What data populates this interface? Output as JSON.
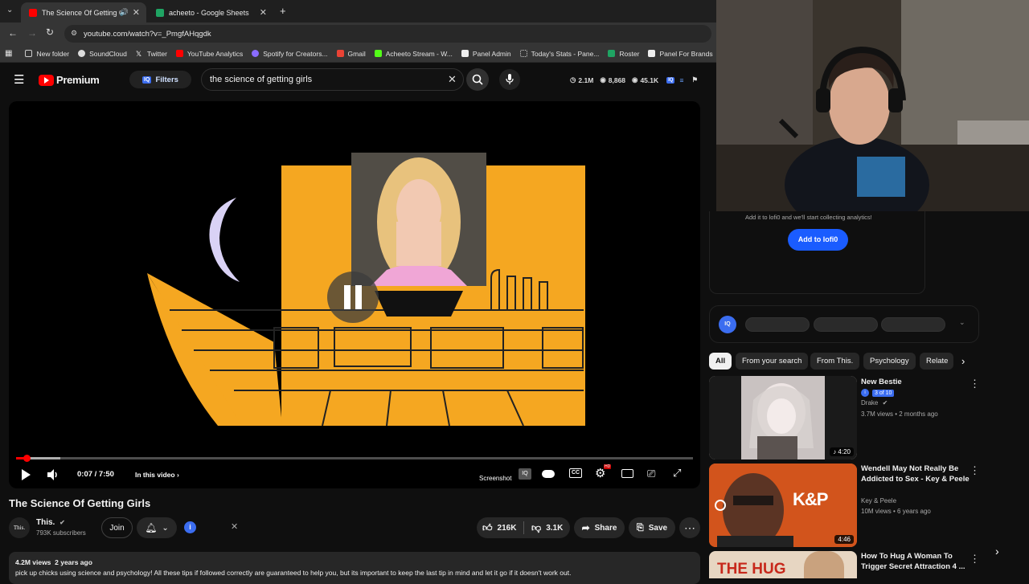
{
  "browser": {
    "tabs": [
      {
        "title": "The Science Of Getting Girls",
        "active": true
      },
      {
        "title": "acheeto - Google Sheets",
        "active": false
      }
    ],
    "url": "youtube.com/watch?v=_PmgfAHqgdk",
    "bookmarks": [
      "New folder",
      "SoundCloud",
      "Twitter",
      "YouTube Analytics",
      "Spotify for Creators...",
      "Gmail",
      "Acheeto Stream - W...",
      "Panel Admin",
      "Today's Stats - Pane...",
      "Roster",
      "Panel For Brands"
    ]
  },
  "header": {
    "logo": "Premium",
    "filters": "Filters",
    "search_value": "the science of getting girls",
    "stats": {
      "views": "2.1M",
      "watching": "8,868",
      "subs": "45.1K"
    }
  },
  "player": {
    "time": "0:07 / 7:50",
    "in_video": "In this video",
    "screenshot": "Screenshot",
    "progress": 0.015
  },
  "video": {
    "title": "The Science Of Getting Girls",
    "channel": "This.",
    "subscribers": "793K subscribers",
    "join": "Join",
    "likes": "216K",
    "dislikes": "3.1K",
    "share": "Share",
    "save": "Save",
    "views_age": "4.2M views  2 years ago",
    "description": "pick up chicks using science and psychology! All these tips if followed correctly are guaranteed to help you, but its important to keep the last tip in mind and let it go if it doesn't work out."
  },
  "panel": {
    "analytics_msg": "Add it to lofi0 and we'll start collecting analytics!",
    "add_button": "Add to lofi0",
    "chips": [
      "All",
      "From your search",
      "From This.",
      "Psychology",
      "Relate"
    ]
  },
  "recommendations": [
    {
      "title": "New Bestie",
      "badge": "3 of 10",
      "channel": "Drake",
      "meta": "3.7M views • 2 months ago",
      "duration": "4:20"
    },
    {
      "title_l1": "Wendell May Not Really Be",
      "title_l2": "Addicted to Sex - Key & Peele",
      "channel": "Key & Peele",
      "meta": "10M views • 6 years ago",
      "duration": "4:46",
      "thumb_text": "K&P"
    },
    {
      "title_l1": "How To Hug A Woman To",
      "title_l2": "Trigger Secret Attraction 4 ...",
      "thumb_text": "THE HUG"
    }
  ],
  "colors": {
    "accent": "#3ea6ff",
    "brand_red": "#ff0000",
    "add_button": "#1a5cff",
    "video_bg": "#f5a721"
  }
}
